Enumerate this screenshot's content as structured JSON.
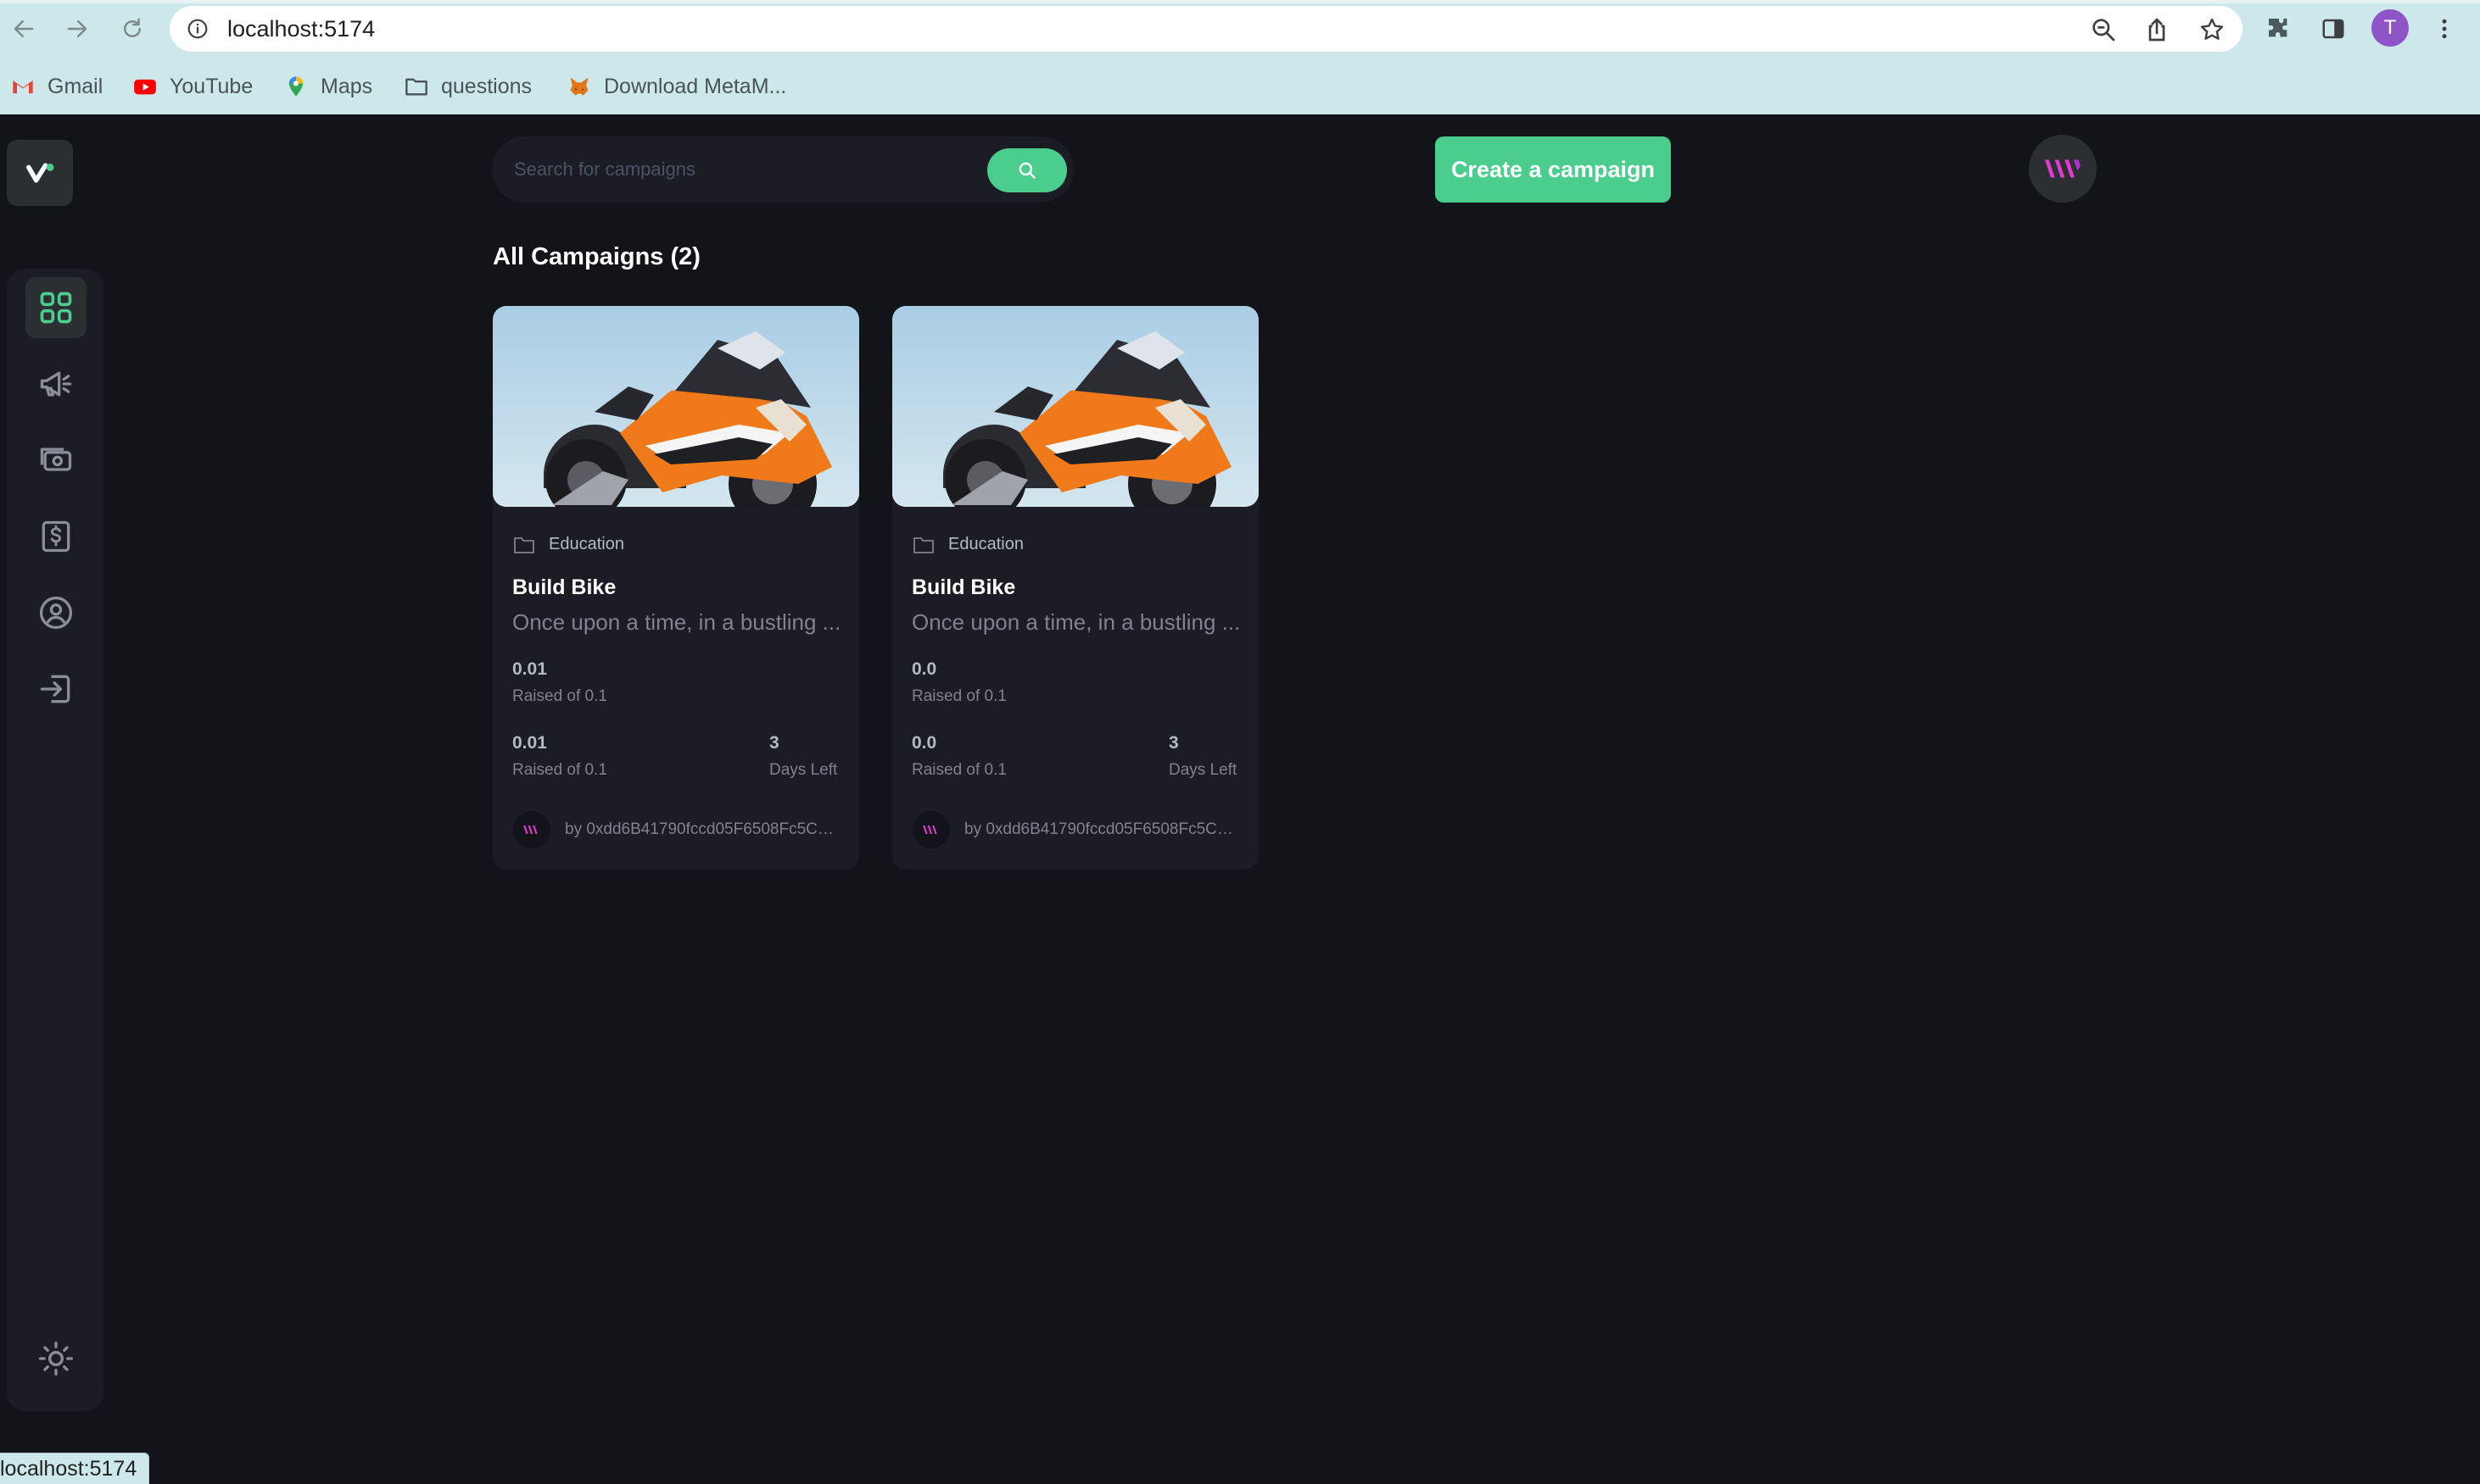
{
  "browser": {
    "url": "localhost:5174",
    "bookmarks": [
      {
        "label": "Gmail",
        "icon": "gmail-icon"
      },
      {
        "label": "YouTube",
        "icon": "youtube-icon"
      },
      {
        "label": "Maps",
        "icon": "maps-icon"
      },
      {
        "label": "questions",
        "icon": "folder-icon"
      },
      {
        "label": "Download MetaM...",
        "icon": "metamask-icon"
      }
    ],
    "profile_initial": "T",
    "status_url": "localhost:5174"
  },
  "app": {
    "search": {
      "placeholder": "Search for campaigns"
    },
    "create_button": "Create a campaign",
    "heading": "All Campaigns (2)",
    "accent_color": "#4acd8d",
    "sidebar": [
      "dashboard-icon",
      "campaign-icon",
      "payment-icon",
      "withdraw-icon",
      "profile-icon",
      "logout-icon"
    ],
    "campaigns": [
      {
        "category": "Education",
        "title": "Build Bike",
        "description": "Once upon a time, in a bustling ...",
        "raised_1": "0.01",
        "raised_label_1": "Raised of 0.1",
        "raised_2": "0.01",
        "raised_label_2": "Raised of 0.1",
        "days": "3",
        "days_label": "Days Left",
        "owner": "by 0xdd6B41790fccd05F6508Fc5CBF..."
      },
      {
        "category": "Education",
        "title": "Build Bike",
        "description": "Once upon a time, in a bustling ...",
        "raised_1": "0.0",
        "raised_label_1": "Raised of 0.1",
        "raised_2": "0.0",
        "raised_label_2": "Raised of 0.1",
        "days": "3",
        "days_label": "Days Left",
        "owner": "by 0xdd6B41790fccd05F6508Fc5CBF..."
      }
    ]
  }
}
